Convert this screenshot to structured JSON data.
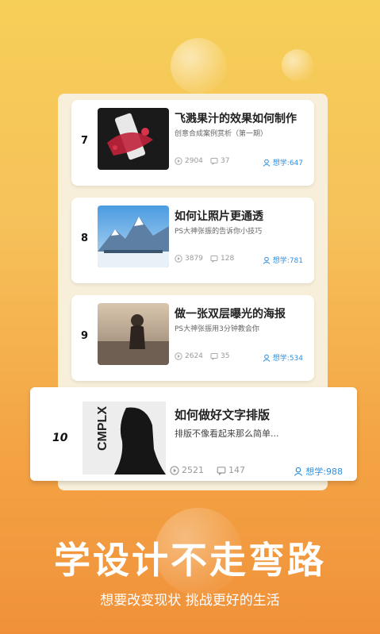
{
  "courses": [
    {
      "rank": "7",
      "title": "飞溅果汁的效果如何制作",
      "subtitle": "创意合成案例赏析（第一期）",
      "views": "2904",
      "comments": "37",
      "learn": "想学:647"
    },
    {
      "rank": "8",
      "title": "如何让照片更通透",
      "subtitle": "PS大神张振的告诉你小技巧",
      "views": "3879",
      "comments": "128",
      "learn": "想学:781"
    },
    {
      "rank": "9",
      "title": "做一张双层曝光的海报",
      "subtitle": "PS大神张振用3分钟教会你",
      "views": "2624",
      "comments": "35",
      "learn": "想学:534"
    }
  ],
  "featured": {
    "rank": "10",
    "title": "如何做好文字排版",
    "subtitle": "排版不像看起来那么简单...",
    "views": "2521",
    "comments": "147",
    "learn": "想学:988",
    "thumb_text": "CMPLX"
  },
  "headline": "学设计不走弯路",
  "tagline": "想要改变现状 挑战更好的生活",
  "icons": {
    "views": "play-circle-icon",
    "comments": "comment-icon",
    "learn": "user-icon"
  },
  "colors": {
    "accent_blue": "#2f8fe0",
    "bg_top": "#f6cf58",
    "bg_bottom": "#f0913a"
  }
}
